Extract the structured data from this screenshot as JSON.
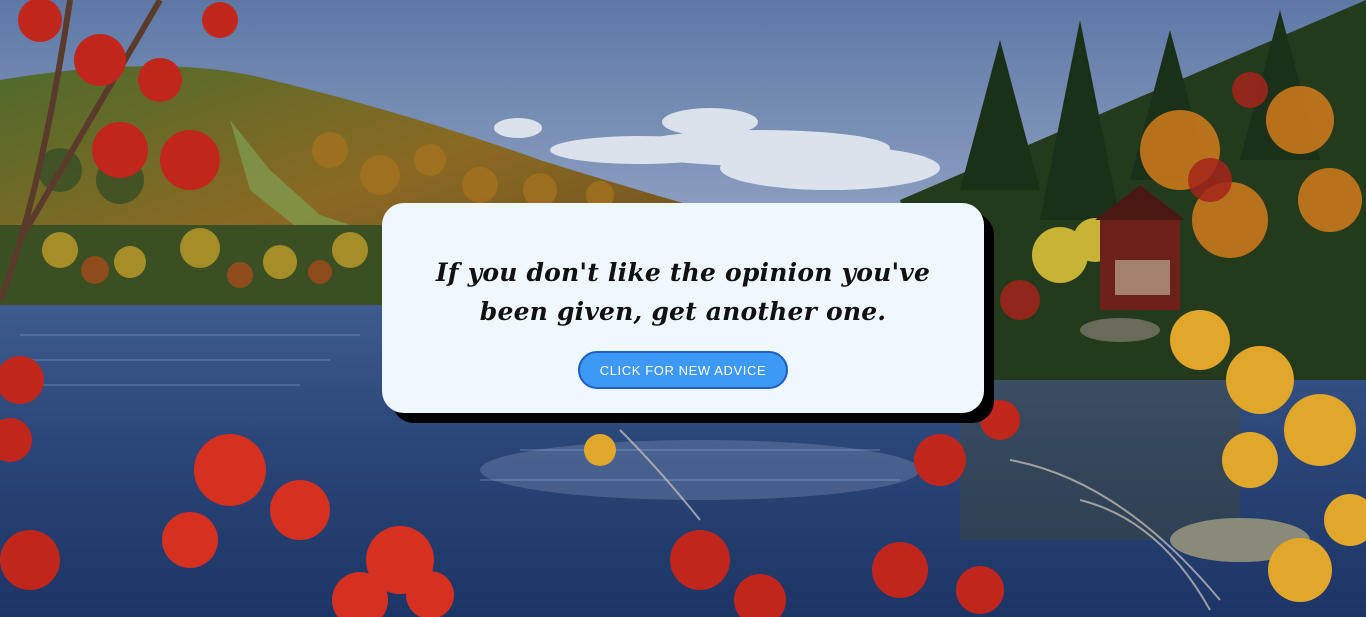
{
  "page": {
    "background_description": "autumn lake landscape with mountain, evergreen and red/yellow foliage"
  },
  "advice": {
    "text": "If you don't like the opinion you've been given, get another one."
  },
  "button": {
    "label": "CLICK FOR NEW ADVICE"
  },
  "colors": {
    "card_bg": "#eff7ff",
    "card_shadow": "#000000",
    "button_bg": "#3d99f5",
    "button_border": "#1f5fbf",
    "button_text": "#ffffff",
    "advice_text": "#111111"
  }
}
